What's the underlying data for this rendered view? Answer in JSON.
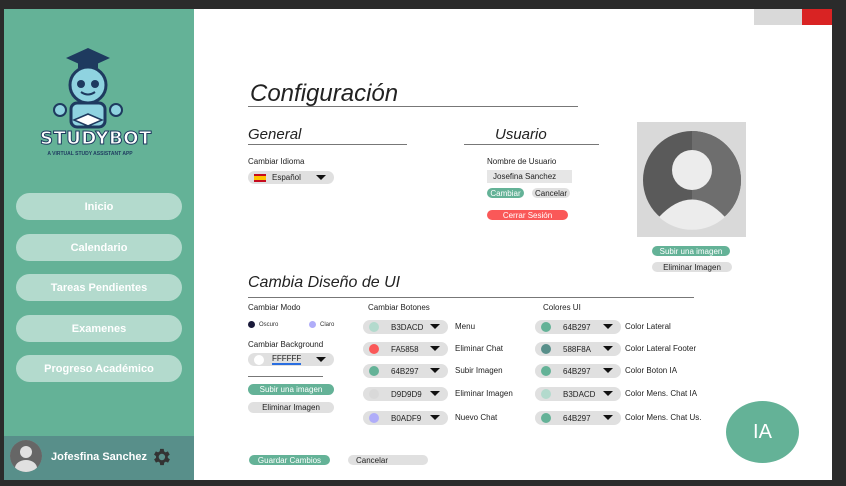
{
  "app": {
    "logo_title": "STUDYBOT",
    "logo_subtitle": "A VIRTUAL STUDY ASSISTANT APP"
  },
  "sidebar": {
    "items": [
      {
        "label": "Inicio"
      },
      {
        "label": "Calendario"
      },
      {
        "label": "Tareas Pendientes"
      },
      {
        "label": "Examenes"
      },
      {
        "label": "Progreso Académico"
      }
    ],
    "user_name": "Jofesfina Sanchez"
  },
  "page": {
    "title": "Configuración"
  },
  "general": {
    "heading": "General",
    "language_label": "Cambiar Idioma",
    "language_value": "Español"
  },
  "usuario": {
    "heading": "Usuario",
    "username_label": "Nombre de Usuario",
    "username_value": "Josefina Sanchez",
    "change_label": "Cambiar",
    "cancel_label": "Cancelar",
    "logout_label": "Cerrar Sesión"
  },
  "profile_photo": {
    "upload_label": "Subir una imagen",
    "delete_label": "Eliminar Imagen"
  },
  "ui_design": {
    "heading": "Cambia Diseño de UI",
    "mode_label": "Cambiar Modo",
    "mode_dark": "Oscuro",
    "mode_light": "Claro",
    "background_label": "Cambiar Background",
    "background_value": "FFFFFF",
    "bg_upload_label": "Subir una imagen",
    "bg_delete_label": "Eliminar Imagen",
    "buttons_label": "Cambiar Botones",
    "colors_label": "Colores UI",
    "buttons": [
      {
        "hex": "B3DACD",
        "color": "#B3DACD",
        "name": "Menu"
      },
      {
        "hex": "FA5858",
        "color": "#FA5858",
        "name": "Eliminar Chat"
      },
      {
        "hex": "64B297",
        "color": "#64B297",
        "name": "Subir Imagen"
      },
      {
        "hex": "D9D9D9",
        "color": "#D9D9D9",
        "name": "Eliminar Imagen"
      },
      {
        "hex": "B0ADF9",
        "color": "#B0ADF9",
        "name": "Nuevo Chat"
      }
    ],
    "colors": [
      {
        "hex": "64B297",
        "color": "#64B297",
        "name": "Color Lateral"
      },
      {
        "hex": "588F8A",
        "color": "#588F8A",
        "name": "Color Lateral Footer"
      },
      {
        "hex": "64B297",
        "color": "#64B297",
        "name": "Color Boton IA"
      },
      {
        "hex": "B3DACD",
        "color": "#B3DACD",
        "name": "Color Mens. Chat IA"
      },
      {
        "hex": "64B297",
        "color": "#64B297",
        "name": "Color Mens. Chat Us."
      }
    ]
  },
  "footer": {
    "save_label": "Guardar Cambios",
    "cancel_label": "Cancelar"
  },
  "ia_button": {
    "label": "IA"
  },
  "colors": {
    "accent": "#64B297",
    "accent_light": "#B3DACD",
    "footer": "#588F8A",
    "danger": "#FA5858"
  }
}
